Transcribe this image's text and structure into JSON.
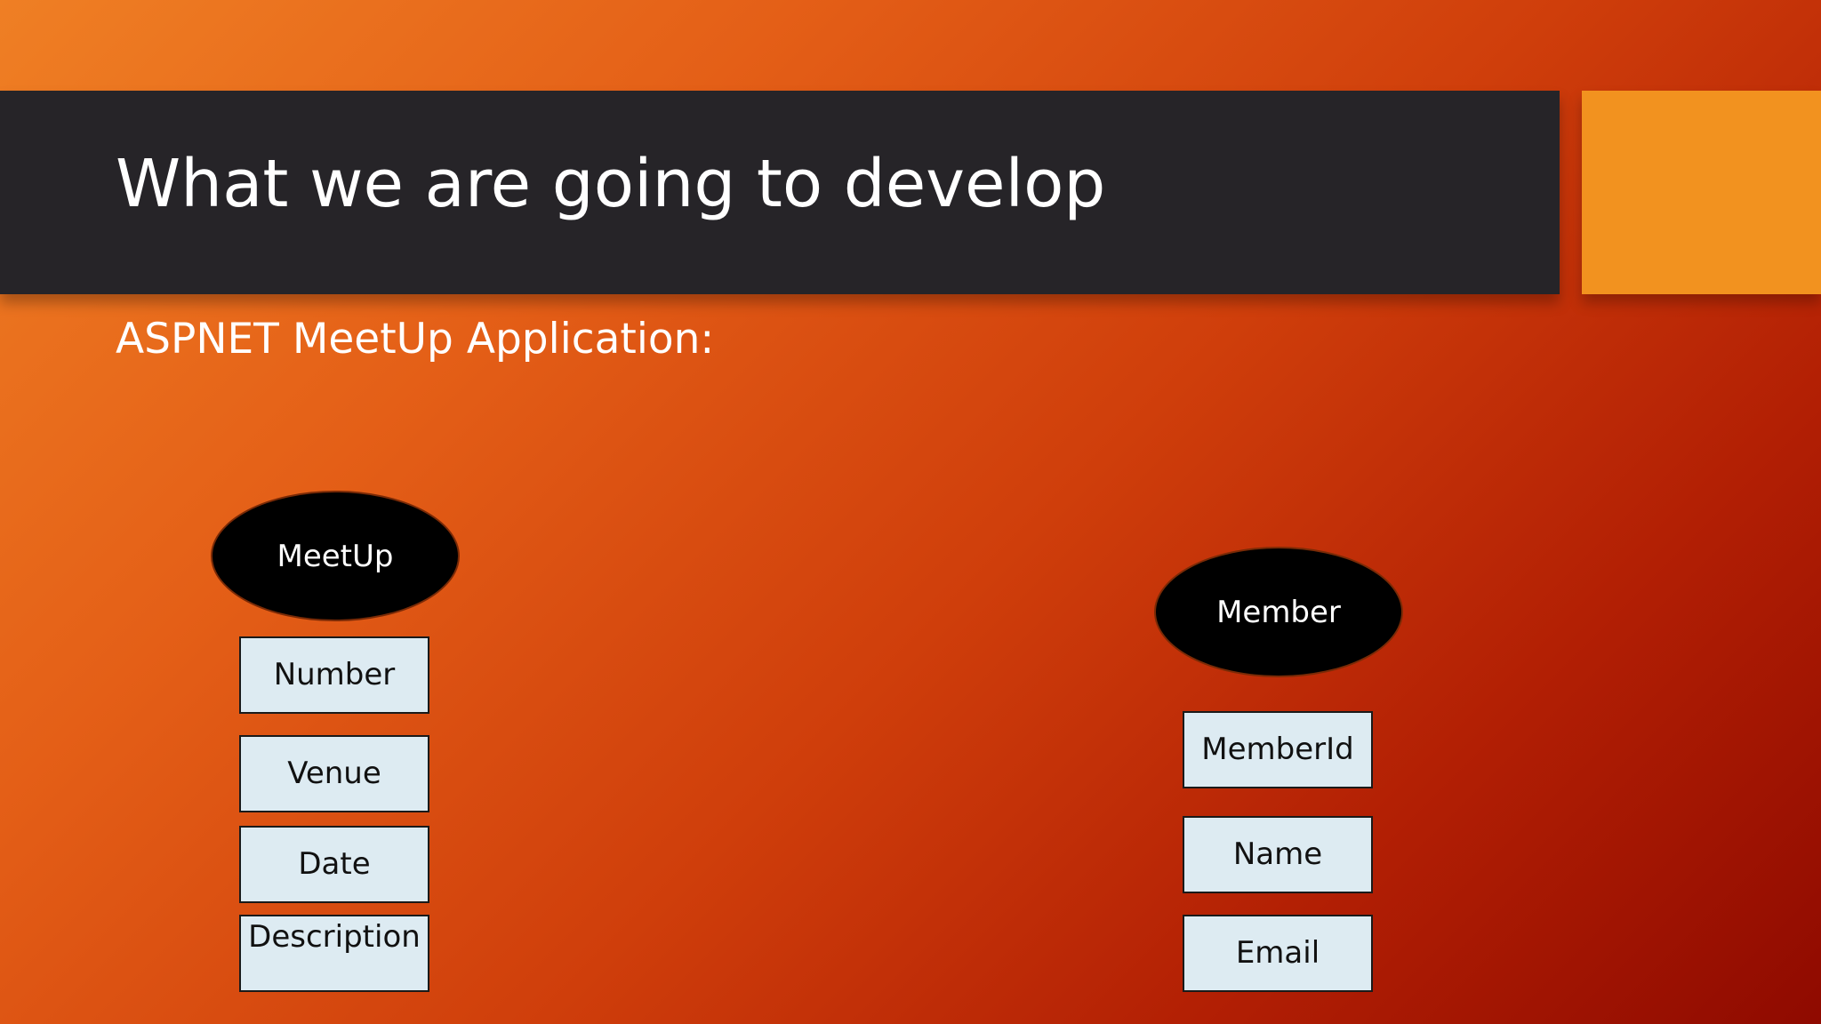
{
  "slide": {
    "title": "What we are going to develop",
    "subtitle": "ASPNET MeetUp Application:"
  },
  "entities": {
    "meetup": {
      "name": "MeetUp",
      "attributes": [
        "Number",
        "Venue",
        "Date",
        "Description"
      ]
    },
    "member": {
      "name": "Member",
      "attributes": [
        "MemberId",
        "Name",
        "Email"
      ]
    }
  },
  "colors": {
    "title_bar": "#262428",
    "accent": "#f2921f",
    "entity_fill": "#000000",
    "attribute_fill": "#ddebf2"
  }
}
